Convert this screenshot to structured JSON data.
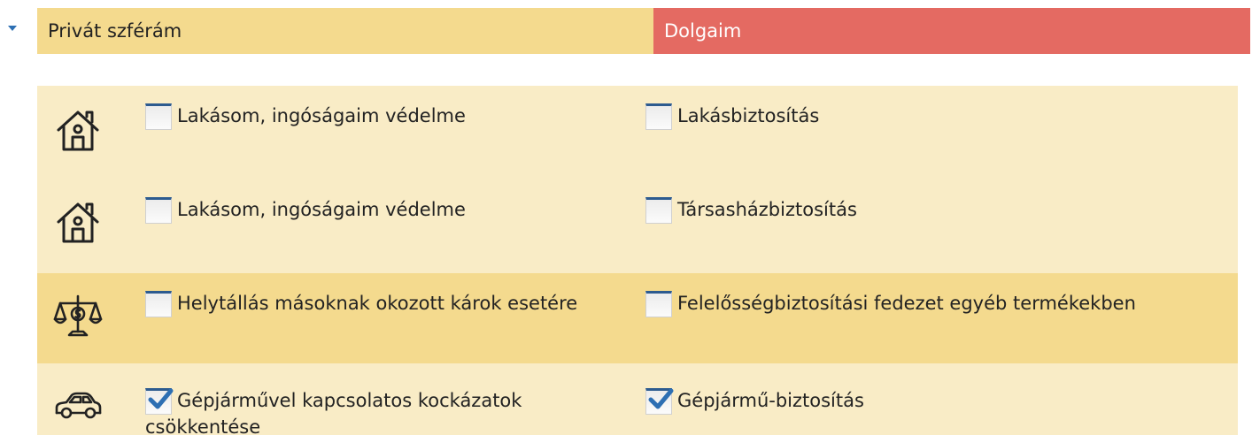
{
  "header": {
    "left_label": "Privát szférám",
    "right_label": "Dolgaim",
    "left_color": "#f4da8e",
    "right_color": "#e46a62"
  },
  "rows": [
    {
      "icon": "house-icon",
      "need_label": "Lakásom, ingóságaim védelme",
      "need_checked": false,
      "product_label": "Lakásbiztosítás",
      "product_checked": false
    },
    {
      "icon": "house-icon",
      "need_label": "Lakásom, ingóságaim védelme",
      "need_checked": false,
      "product_label": "Társasházbiztosítás",
      "product_checked": false
    },
    {
      "icon": "scales-icon",
      "need_label": "Helytállás másoknak okozott károk esetére",
      "need_checked": false,
      "product_label": "Felelősségbiztosítási fedezet egyéb termékekben",
      "product_checked": false
    },
    {
      "icon": "car-icon",
      "need_label": "Gépjárművel kapcsolatos kockázatok csökkentése",
      "need_checked": true,
      "product_label": "Gépjármű-biztosítás",
      "product_checked": true
    }
  ]
}
